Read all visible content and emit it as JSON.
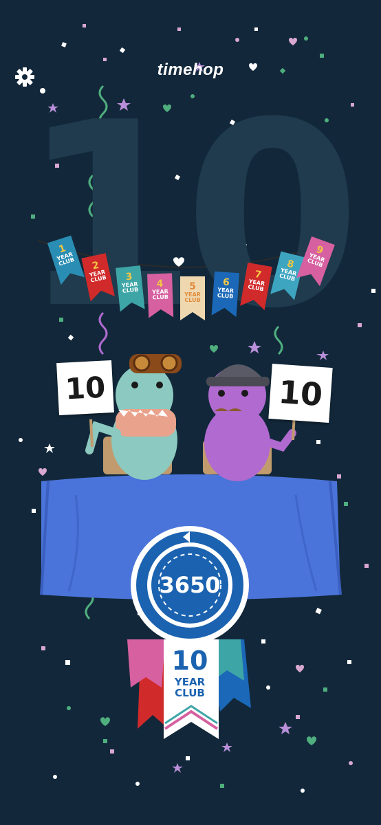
{
  "header": {
    "logo_text": "timehop",
    "settings_icon": "gear-icon"
  },
  "background": {
    "big_number": "10"
  },
  "banner": {
    "flags": [
      {
        "number": "1",
        "line1": "YEAR",
        "line2": "CLUB",
        "color": "#2a8db3",
        "num_color": "#f2c744"
      },
      {
        "number": "2",
        "line1": "YEAR",
        "line2": "CLUB",
        "color": "#d12a2a",
        "num_color": "#f2c744"
      },
      {
        "number": "3",
        "line1": "YEAR",
        "line2": "CLUB",
        "color": "#3ea5a7",
        "num_color": "#f2c744"
      },
      {
        "number": "4",
        "line1": "YEAR",
        "line2": "CLUB",
        "color": "#d660a0",
        "num_color": "#f2c744"
      },
      {
        "number": "5",
        "line1": "YEAR",
        "line2": "CLUB",
        "color": "#efd8b0",
        "num_color": "#e08a3a"
      },
      {
        "number": "6",
        "line1": "YEAR",
        "line2": "CLUB",
        "color": "#1b68b8",
        "num_color": "#f2c744"
      },
      {
        "number": "7",
        "line1": "YEAR",
        "line2": "CLUB",
        "color": "#d12a2a",
        "num_color": "#f2c744"
      },
      {
        "number": "8",
        "line1": "YEAR",
        "line2": "CLUB",
        "color": "#3ea5c0",
        "num_color": "#f2c744"
      },
      {
        "number": "9",
        "line1": "YEAR",
        "line2": "CLUB",
        "color": "#d660a0",
        "num_color": "#f2c744"
      }
    ]
  },
  "judges": {
    "left_sign": "10",
    "right_sign": "10"
  },
  "medal": {
    "count": "3650",
    "club_number": "10",
    "club_line1": "YEAR",
    "club_line2": "CLUB"
  },
  "colors": {
    "background": "#12283a",
    "table": "#4a74d9",
    "teal_dino": "#8cc9c0",
    "purple_dino": "#b06ad0",
    "medal_blue": "#1b63b0"
  }
}
